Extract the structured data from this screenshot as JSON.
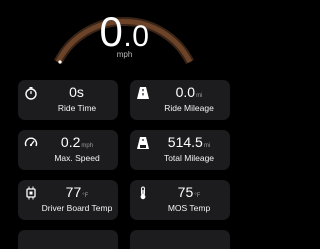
{
  "speedometer": {
    "speed_int": "0",
    "speed_dec": ".0",
    "unit": "mph",
    "colors": {
      "arc": "#5a3a25",
      "arc_highlight": "#b5693a",
      "indicator": "#ffffff"
    }
  },
  "stats": [
    {
      "value": "0s",
      "unit": "",
      "label": "Ride Time",
      "icon": "stopwatch-icon"
    },
    {
      "value": "0.0",
      "unit": "mi",
      "label": "Ride Mileage",
      "icon": "road-icon"
    },
    {
      "value": "0.2",
      "unit": "mph",
      "label": "Max. Speed",
      "icon": "speedometer-icon"
    },
    {
      "value": "514.5",
      "unit": "mi",
      "label": "Total Mileage",
      "icon": "road-total-icon"
    },
    {
      "value": "77",
      "unit": "°F",
      "label": "Driver Board Temp",
      "icon": "circuit-board-icon"
    },
    {
      "value": "75",
      "unit": "°F",
      "label": "MOS Temp",
      "icon": "thermometer-icon"
    }
  ],
  "colors": {
    "background": "#000000",
    "card": "#1c1c1e"
  }
}
